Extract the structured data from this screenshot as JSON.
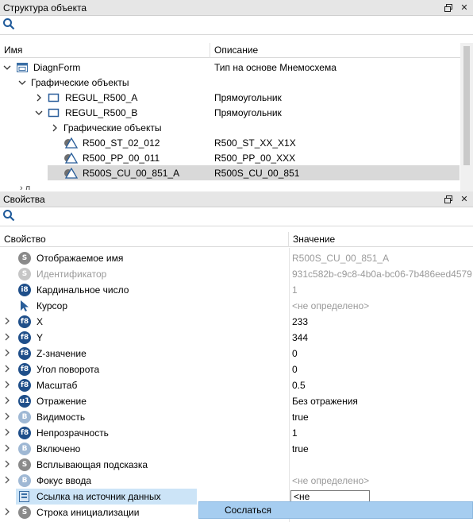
{
  "structure_panel": {
    "title": "Структура объекта",
    "columns": [
      "Имя",
      "Описание"
    ],
    "rows": [
      {
        "level": 0,
        "expand": "v",
        "icon": "form",
        "name": "DiagnForm",
        "desc": "Тип на основе Мнемосхема",
        "selected": false
      },
      {
        "level": 1,
        "expand": "v",
        "icon": "",
        "name": "Графические объекты",
        "desc": "",
        "selected": false
      },
      {
        "level": 2,
        "expand": ">",
        "icon": "rect",
        "name": "REGUL_R500_A",
        "desc": "Прямоугольник",
        "selected": false
      },
      {
        "level": 2,
        "expand": "v",
        "icon": "rect",
        "name": "REGUL_R500_B",
        "desc": "Прямоугольник",
        "selected": false
      },
      {
        "level": 3,
        "expand": ">",
        "icon": "",
        "name": "Графические объекты",
        "desc": "",
        "selected": false
      },
      {
        "level": 3,
        "expand": "",
        "icon": "link",
        "name": "R500_ST_02_012",
        "desc": "R500_ST_XX_X1X",
        "selected": false
      },
      {
        "level": 3,
        "expand": "",
        "icon": "link",
        "name": "R500_PP_00_011",
        "desc": "R500_PP_00_XXX",
        "selected": false
      },
      {
        "level": 3,
        "expand": "",
        "icon": "link",
        "name": "R500S_CU_00_851_A",
        "desc": "R500S_CU_00_851",
        "selected": true
      }
    ]
  },
  "properties_panel": {
    "title": "Свойства",
    "columns": [
      "Свойство",
      "Значение"
    ],
    "rows": [
      {
        "expand": "",
        "badge": "S",
        "kind": "s",
        "name": "Отображаемое имя",
        "value": "R500S_CU_00_851_A",
        "dim_value": true,
        "dim": false
      },
      {
        "expand": "",
        "badge": "S",
        "kind": "sd",
        "name": "Идентификатор",
        "value": "931c582b-c9c8-4b0a-bc06-7b486eed4579",
        "dim_value": true,
        "dim": true
      },
      {
        "expand": "",
        "badge": "i8",
        "kind": "i8",
        "name": "Кардинальное число",
        "value": "1",
        "dim_value": true,
        "dim": false
      },
      {
        "expand": "",
        "badge": "cursor",
        "kind": "cursor",
        "name": "Курсор",
        "value": "<не определено>",
        "dim_value": true,
        "dim": false
      },
      {
        "expand": ">",
        "badge": "f8",
        "kind": "f8",
        "name": "X",
        "value": "233",
        "dim_value": false,
        "dim": false
      },
      {
        "expand": ">",
        "badge": "f8",
        "kind": "f8",
        "name": "Y",
        "value": "344",
        "dim_value": false,
        "dim": false
      },
      {
        "expand": ">",
        "badge": "f8",
        "kind": "f8",
        "name": "Z-значение",
        "value": "0",
        "dim_value": false,
        "dim": false
      },
      {
        "expand": ">",
        "badge": "f8",
        "kind": "f8",
        "name": "Угол поворота",
        "value": "0",
        "dim_value": false,
        "dim": false
      },
      {
        "expand": ">",
        "badge": "f8",
        "kind": "f8",
        "name": "Масштаб",
        "value": "0.5",
        "dim_value": false,
        "dim": false
      },
      {
        "expand": ">",
        "badge": "u1",
        "kind": "u1",
        "name": "Отражение",
        "value": "Без отражения",
        "dim_value": false,
        "dim": false
      },
      {
        "expand": ">",
        "badge": "B",
        "kind": "b",
        "name": "Видимость",
        "value": "true",
        "dim_value": false,
        "dim": false
      },
      {
        "expand": ">",
        "badge": "f8",
        "kind": "f8",
        "name": "Непрозрачность",
        "value": "1",
        "dim_value": false,
        "dim": false
      },
      {
        "expand": ">",
        "badge": "B",
        "kind": "b",
        "name": "Включено",
        "value": "true",
        "dim_value": false,
        "dim": false
      },
      {
        "expand": ">",
        "badge": "S",
        "kind": "s",
        "name": "Всплывающая подсказка",
        "value": "",
        "dim_value": false,
        "dim": false
      },
      {
        "expand": ">",
        "badge": "B",
        "kind": "b",
        "name": "Фокус ввода",
        "value": "<не определено>",
        "dim_value": true,
        "dim": false
      },
      {
        "expand": "",
        "badge": "link",
        "kind": "link",
        "name": "Ссылка на источник данных",
        "value": "<не определено>",
        "dim_value": false,
        "dim": false
      },
      {
        "expand": ">",
        "badge": "S",
        "kind": "s",
        "name": "Строка инициализации",
        "value": "",
        "dim_value": false,
        "dim": false
      }
    ]
  },
  "context_menu": {
    "item": "Сослаться"
  },
  "colors": {
    "selection": "#d9d9d9",
    "menu_highlight": "#a6cdf0",
    "badge_blue": "#1f4f8a",
    "badge_gray": "#8a8a8a"
  }
}
